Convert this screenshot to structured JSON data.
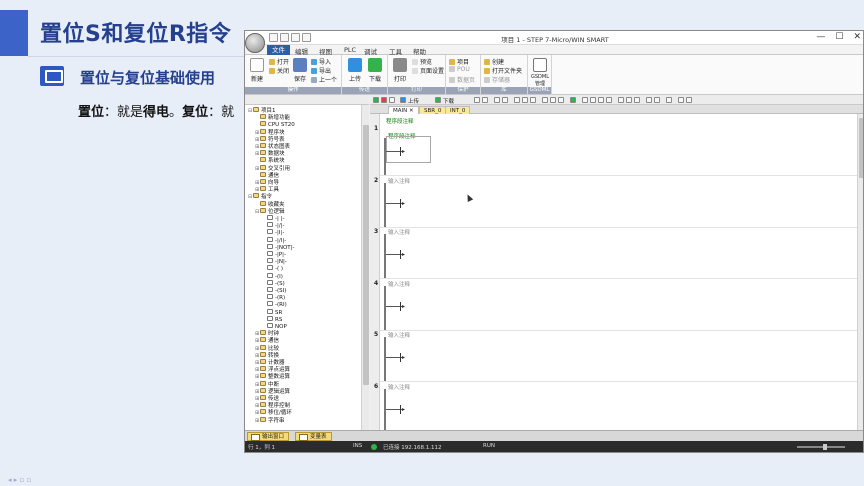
{
  "slide": {
    "title": "置位S和复位R指令",
    "subtitle": "置位与复位基础使用",
    "body_label_set": "置位",
    "body_text_1": "：就是",
    "body_bold_1": "得电",
    "body_text_2": "。",
    "body_label_reset": "复位",
    "body_text_3": "：就"
  },
  "app": {
    "window_title": "项目 1 - STEP 7-Micro/WIN SMART",
    "window_controls": [
      "—",
      "☐",
      "✕"
    ],
    "ribbon_tabs": [
      "文件",
      "编辑",
      "视图",
      "PLC",
      "调试",
      "工具",
      "帮助"
    ],
    "active_tab_index": 0,
    "groups": {
      "operation": {
        "label": "操作",
        "new_label": "新建",
        "open_label": "打开",
        "close_label": "关闭",
        "save_label": "保存",
        "import_label": "导入",
        "export_label": "导出",
        "previous_label": "上一个"
      },
      "transfer": {
        "label": "传送",
        "upload_label": "上传",
        "download_label": "下载"
      },
      "print": {
        "label": "打印",
        "print_label": "打印",
        "preview_label": "预览",
        "page_setup_label": "页面设置"
      },
      "protect": {
        "label": "保护",
        "project_label": "项目",
        "pou_label": "POU",
        "data_page_label": "数据页"
      },
      "library": {
        "label": "库",
        "create_label": "创建",
        "open_lib_label": "打开文件夹",
        "memory_label": "存储器"
      },
      "gsdml": {
        "label": "GSDML",
        "manage_label": "GSDML\n管理"
      }
    },
    "editor_toolbar": {
      "upload_label": "上传",
      "download_label": "下载"
    },
    "doc_tabs": [
      "MAIN",
      "SBR_0",
      "INT_0"
    ],
    "pou_comment": "程序段注释",
    "networks": [
      {
        "num": "1",
        "comment": "程序段注释"
      },
      {
        "num": "2",
        "comment": "输入注释"
      },
      {
        "num": "3",
        "comment": "输入注释"
      },
      {
        "num": "4",
        "comment": "输入注释"
      },
      {
        "num": "5",
        "comment": "输入注释"
      },
      {
        "num": "6",
        "comment": "输入注释"
      }
    ],
    "tree": [
      {
        "label": "项目1",
        "level": 0,
        "toggle": "⊟"
      },
      {
        "label": "新增功能",
        "level": 1,
        "toggle": ""
      },
      {
        "label": "CPU ST20",
        "level": 1,
        "toggle": ""
      },
      {
        "label": "程序块",
        "level": 1,
        "toggle": "⊞"
      },
      {
        "label": "符号表",
        "level": 1,
        "toggle": "⊞"
      },
      {
        "label": "状态图表",
        "level": 1,
        "toggle": "⊞"
      },
      {
        "label": "数据块",
        "level": 1,
        "toggle": "⊞"
      },
      {
        "label": "系统块",
        "level": 1,
        "toggle": ""
      },
      {
        "label": "交叉引用",
        "level": 1,
        "toggle": "⊞"
      },
      {
        "label": "通信",
        "level": 1,
        "toggle": ""
      },
      {
        "label": "向导",
        "level": 1,
        "toggle": "⊞"
      },
      {
        "label": "工具",
        "level": 1,
        "toggle": "⊞"
      },
      {
        "label": "指令",
        "level": 0,
        "toggle": "⊟"
      },
      {
        "label": "收藏夹",
        "level": 1,
        "toggle": ""
      },
      {
        "label": "位逻辑",
        "level": 1,
        "toggle": "⊟"
      },
      {
        "label": "-| |-",
        "level": 2,
        "toggle": ""
      },
      {
        "label": "-|/|-",
        "level": 2,
        "toggle": ""
      },
      {
        "label": "-|I|-",
        "level": 2,
        "toggle": ""
      },
      {
        "label": "-|/I|-",
        "level": 2,
        "toggle": ""
      },
      {
        "label": "-|NOT|-",
        "level": 2,
        "toggle": ""
      },
      {
        "label": "-|P|-",
        "level": 2,
        "toggle": ""
      },
      {
        "label": "-|N|-",
        "level": 2,
        "toggle": ""
      },
      {
        "label": "-( )",
        "level": 2,
        "toggle": ""
      },
      {
        "label": "-(I)",
        "level": 2,
        "toggle": ""
      },
      {
        "label": "-(S)",
        "level": 2,
        "toggle": ""
      },
      {
        "label": "-(SI)",
        "level": 2,
        "toggle": ""
      },
      {
        "label": "-(R)",
        "level": 2,
        "toggle": ""
      },
      {
        "label": "-(RI)",
        "level": 2,
        "toggle": ""
      },
      {
        "label": "SR",
        "level": 2,
        "toggle": ""
      },
      {
        "label": "RS",
        "level": 2,
        "toggle": ""
      },
      {
        "label": "NOP",
        "level": 2,
        "toggle": ""
      },
      {
        "label": "时钟",
        "level": 1,
        "toggle": "⊞"
      },
      {
        "label": "通信",
        "level": 1,
        "toggle": "⊞"
      },
      {
        "label": "比较",
        "level": 1,
        "toggle": "⊞"
      },
      {
        "label": "转换",
        "level": 1,
        "toggle": "⊞"
      },
      {
        "label": "计数器",
        "level": 1,
        "toggle": "⊞"
      },
      {
        "label": "浮点运算",
        "level": 1,
        "toggle": "⊞"
      },
      {
        "label": "整数运算",
        "level": 1,
        "toggle": "⊞"
      },
      {
        "label": "中断",
        "level": 1,
        "toggle": "⊞"
      },
      {
        "label": "逻辑运算",
        "level": 1,
        "toggle": "⊞"
      },
      {
        "label": "传送",
        "level": 1,
        "toggle": "⊞"
      },
      {
        "label": "程序控制",
        "level": 1,
        "toggle": "⊞"
      },
      {
        "label": "移位/循环",
        "level": 1,
        "toggle": "⊞"
      },
      {
        "label": "字符串",
        "level": 1,
        "toggle": "⊞"
      }
    ],
    "bottom_tabs": [
      "输出窗口",
      "变量表"
    ],
    "status": {
      "position": "行 1，列 1",
      "mode": "INS",
      "connection": "已连接 192.168.1.112",
      "run_state": "RUN"
    }
  },
  "colors": {
    "accent": "#3b63c8",
    "title_text": "#24408f",
    "ribbon_active": "#2e5da8",
    "status_bar": "#2b2b2b",
    "connected": "#2fb24a",
    "comment_green": "#008000"
  }
}
